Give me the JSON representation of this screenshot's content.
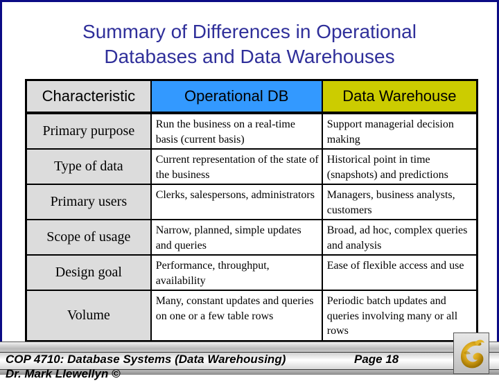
{
  "slide": {
    "title_line1": "Summary of Differences in Operational",
    "title_line2": "Databases and Data Warehouses"
  },
  "table": {
    "headers": [
      "Characteristic",
      "Operational DB",
      "Data Warehouse"
    ],
    "header_colors": {
      "characteristic": "#dcdcdc",
      "operational_db": "#3399ff",
      "data_warehouse": "#cccc00"
    },
    "rows": [
      {
        "characteristic": "Primary purpose",
        "operational_db": "Run the business on a real-time basis (current basis)",
        "data_warehouse": "Support managerial decision making"
      },
      {
        "characteristic": "Type of data",
        "operational_db": "Current representation of the state of the business",
        "data_warehouse": "Historical point in time (snapshots) and  predictions"
      },
      {
        "characteristic": "Primary users",
        "operational_db": "Clerks, salespersons, administrators",
        "data_warehouse": "Managers, business analysts, customers"
      },
      {
        "characteristic": "Scope of usage",
        "operational_db": "Narrow, planned, simple updates and queries",
        "data_warehouse": "Broad, ad hoc, complex queries and analysis"
      },
      {
        "characteristic": "Design goal",
        "operational_db": "Performance, throughput, availability",
        "data_warehouse": "Ease of flexible access and use"
      },
      {
        "characteristic": "Volume",
        "operational_db": "Many, constant updates and queries on one or a few table rows",
        "data_warehouse": "Periodic batch updates and queries involving many or all rows"
      }
    ]
  },
  "footer": {
    "course": "COP 4710: Database Systems  (Data Warehousing)",
    "page": "Page 18",
    "author": "Dr. Mark Llewellyn ©",
    "logo_icon": "pegasus-logo-icon"
  },
  "colors": {
    "frame": "#0b0b85",
    "title": "#2f2f9a",
    "logo_gold": "#d4a017"
  }
}
